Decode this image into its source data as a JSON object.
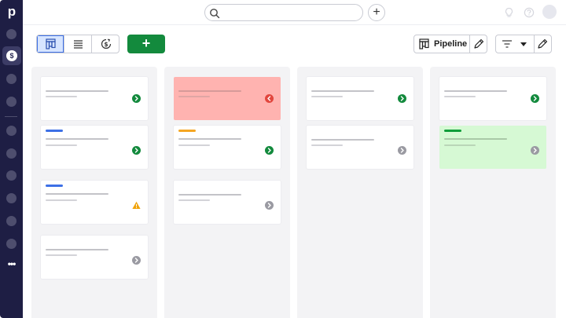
{
  "app": {
    "logo_letter": "p"
  },
  "sidebar": {
    "active_item_icon": "dollar-coin-icon",
    "active_symbol": "$",
    "more_label": "•••"
  },
  "topbar": {
    "search_placeholder": "",
    "add_symbol": "+",
    "icons": [
      "search-icon",
      "add-icon",
      "lightbulb-icon",
      "help-icon",
      "avatar"
    ]
  },
  "toolbar": {
    "views": [
      {
        "icon": "kanban-view-icon",
        "active": true
      },
      {
        "icon": "list-view-icon",
        "active": false
      },
      {
        "icon": "forecast-view-icon",
        "active": false
      }
    ],
    "add_deal_label": "+",
    "pipeline_label": "Pipeline"
  },
  "colors": {
    "sidebar": "#1e1e44",
    "accent_blue": "#3d70e6",
    "accent_orange": "#f5a623",
    "accent_green": "#0f9d3a",
    "status_green": "#138a3d",
    "status_gray": "#9a9aa2",
    "status_red": "#e2463d",
    "warning_yellow": "#f0a30a",
    "card_red": "#ffb3b0",
    "card_green": "#d6f9d4"
  },
  "board": {
    "columns": [
      {
        "cards": [
          {
            "accent": null,
            "status": "green-arrow",
            "bg": "white"
          },
          {
            "accent": "blue",
            "status": "green-arrow",
            "bg": "white"
          },
          {
            "accent": "blue",
            "status": "warning",
            "bg": "white"
          },
          {
            "accent": null,
            "status": "gray-arrow",
            "bg": "white"
          }
        ]
      },
      {
        "cards": [
          {
            "accent": null,
            "status": "red-back-arrow",
            "bg": "red"
          },
          {
            "accent": "orange",
            "status": "green-arrow",
            "bg": "white"
          },
          {
            "accent": null,
            "status": "gray-arrow",
            "bg": "white"
          }
        ]
      },
      {
        "cards": [
          {
            "accent": null,
            "status": "green-arrow",
            "bg": "white"
          },
          {
            "accent": null,
            "status": "gray-arrow",
            "bg": "white"
          }
        ]
      },
      {
        "cards": [
          {
            "accent": null,
            "status": "green-arrow",
            "bg": "white"
          },
          {
            "accent": "green",
            "status": "gray-arrow",
            "bg": "green"
          }
        ]
      }
    ]
  }
}
